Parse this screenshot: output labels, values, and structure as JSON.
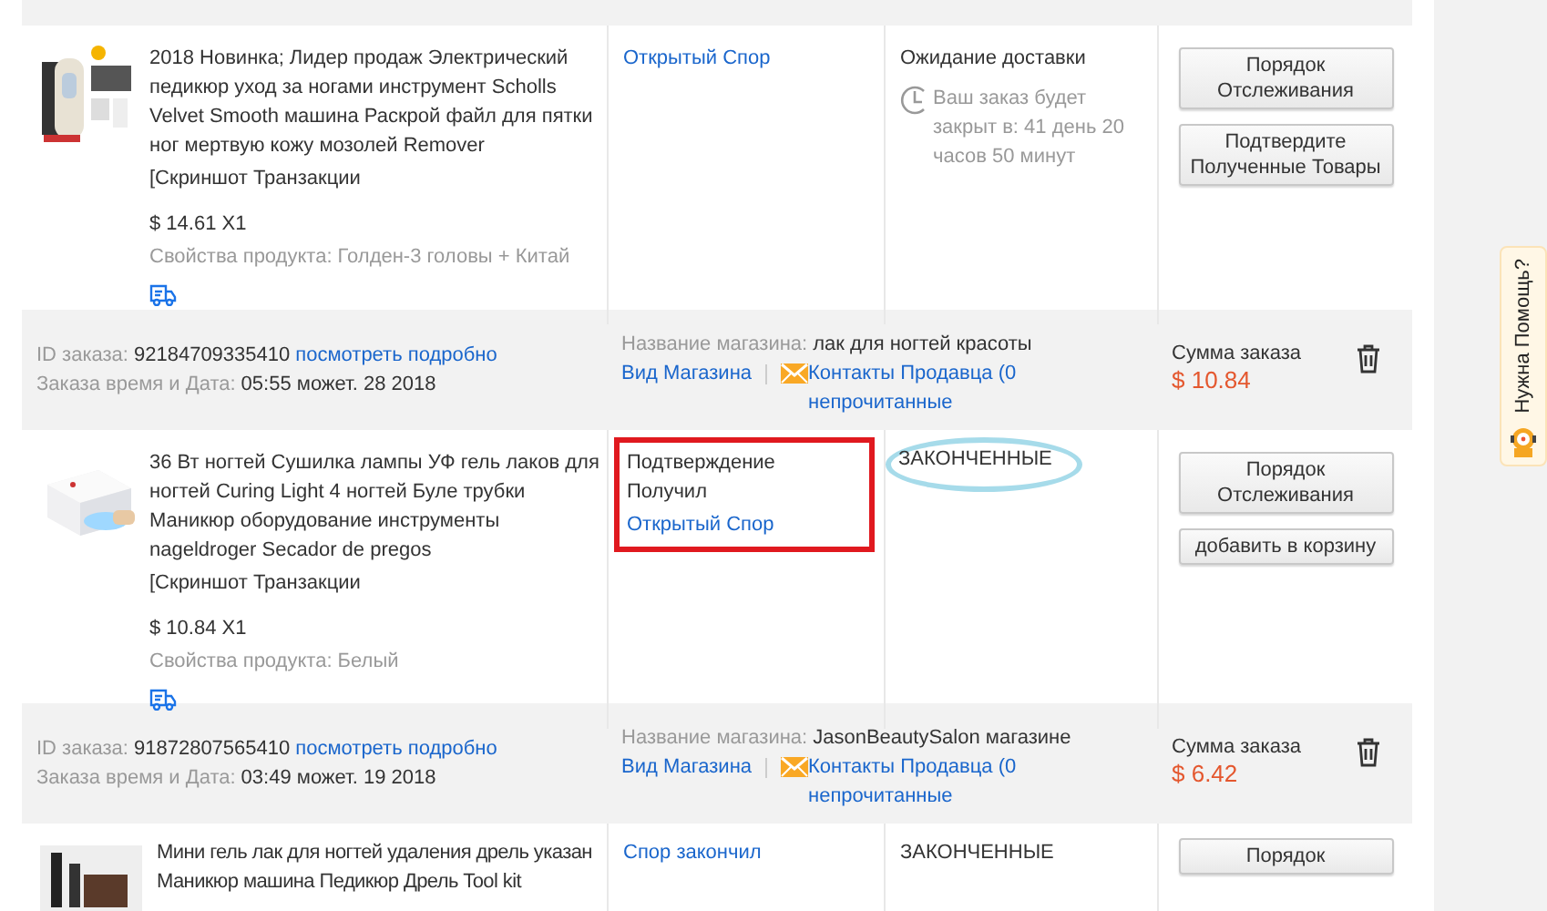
{
  "orders": [
    {
      "item": {
        "title": "2018 Новинка; Лидер продаж Электрический педикюр уход за ногами инструмент Scholls Velvet Smooth машина Раскрой файл для пятки ног мертвую кожу мозолей Remover",
        "snapshot": "[Скриншот Транзакции",
        "price": "$ 14.61 X1",
        "properties": "Свойства продукта: Голден-3 головы + Китай",
        "shipping": true,
        "actions": {
          "highlighted": false,
          "lines": [
            {
              "kind": "link",
              "text": "Открытый Спор"
            }
          ]
        },
        "status": {
          "text": "Ожидание доставки",
          "circled": false,
          "note": "Ваш заказ будет закрыт в: 41 день 20 часов 50 минут"
        },
        "buttons": [
          "Порядок Отслеживания",
          "Подтвердите Полученные Товары"
        ]
      }
    },
    {
      "header": {
        "id_label": "ID заказа:",
        "id": "92184709335410",
        "details_link": "посмотреть подробно",
        "date_label": "Заказа время и Дата:",
        "date": "05:55 может. 28 2018",
        "store_label": "Название магазина:",
        "store": "лак для ногтей красоты",
        "store_link": "Вид Магазина",
        "contact_link": "Контакты Продавца (0 непрочитанные",
        "total_label": "Сумма заказа",
        "total": "$ 10.84"
      },
      "item": {
        "title": "36 Вт ногтей Сушилка лампы УФ гель лаков для ногтей Curing Light 4 ногтей Буле трубки Маникюр оборудование инструменты nageldroger Secador de pregos",
        "snapshot": "[Скриншот Транзакции",
        "price": "$ 10.84 X1",
        "properties": "Свойства продукта: Белый",
        "shipping": true,
        "actions": {
          "highlighted": true,
          "lines": [
            {
              "kind": "text",
              "text": "Подтверждение Получил"
            },
            {
              "kind": "link",
              "text": "Открытый Спор"
            }
          ]
        },
        "status": {
          "text": "ЗАКОНЧЕННЫЕ",
          "circled": true
        },
        "buttons": [
          "Порядок Отслеживания",
          "добавить в корзину"
        ]
      }
    },
    {
      "header": {
        "id_label": "ID заказа:",
        "id": "91872807565410",
        "details_link": "посмотреть подробно",
        "date_label": "Заказа время и Дата:",
        "date": "03:49 может. 19 2018",
        "store_label": "Название магазина:",
        "store": "JasonBeautySalon магазине",
        "store_link": "Вид Магазина",
        "contact_link": "Контакты Продавца (0 непрочитанные",
        "total_label": "Сумма заказа",
        "total": "$ 6.42"
      },
      "item": {
        "title": "Мини гель лак для ногтей удаления дрель указан Маникюр машина Педикюр Дрель Tool kit",
        "shipping": false,
        "actions": {
          "highlighted": false,
          "lines": [
            {
              "kind": "link",
              "text": "Спор закончил"
            }
          ]
        },
        "status": {
          "text": "ЗАКОНЧЕННЫЕ",
          "circled": false
        },
        "buttons": [
          "Порядок"
        ]
      }
    }
  ],
  "help_tab": {
    "text": "Нужна Помощь?"
  }
}
